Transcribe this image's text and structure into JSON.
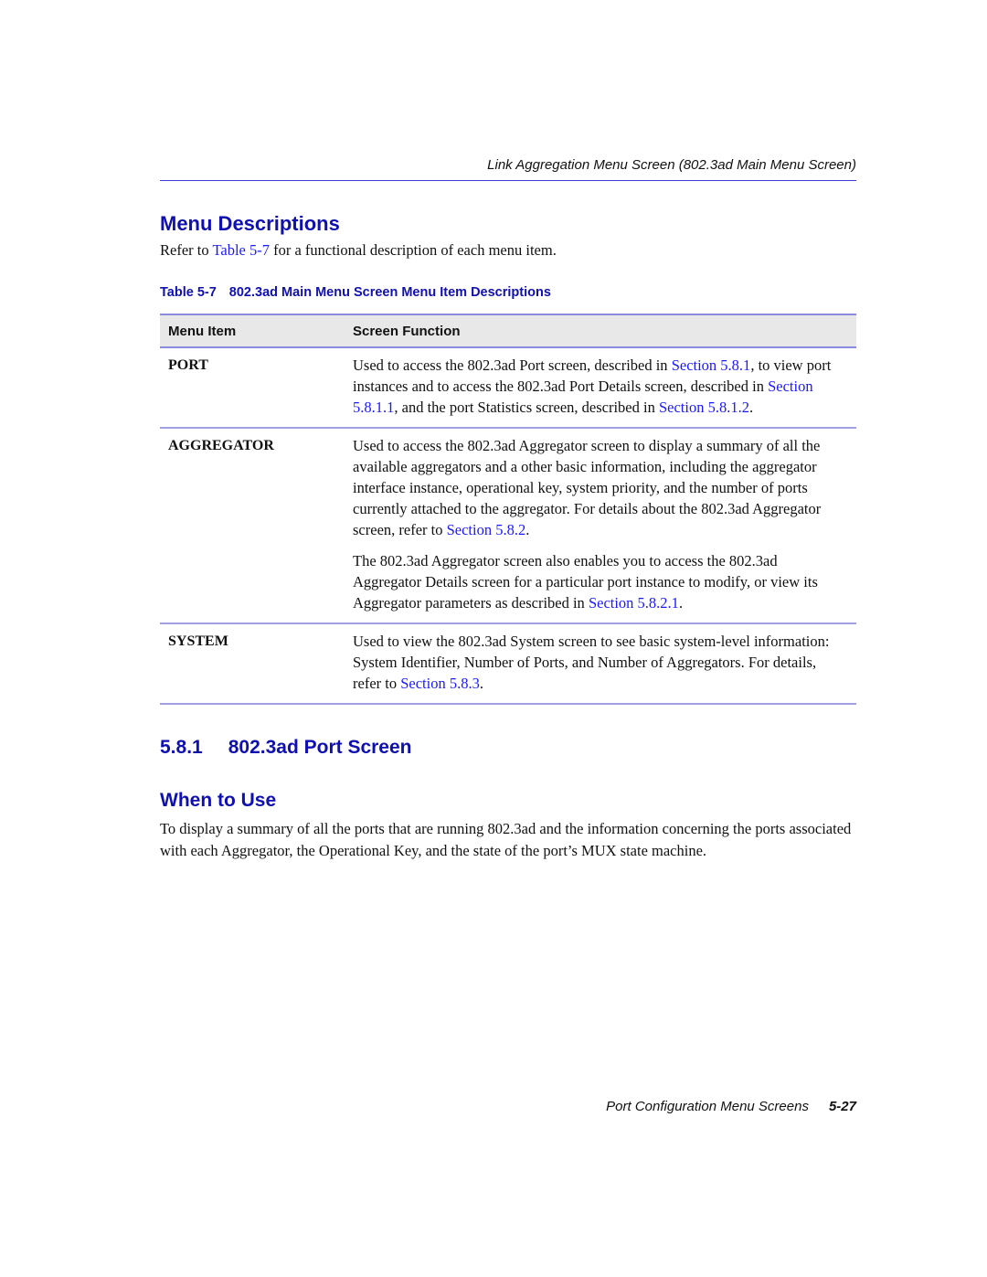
{
  "running_head": "Link Aggregation Menu Screen (802.3ad Main Menu Screen)",
  "menu_descriptions": {
    "heading": "Menu Descriptions",
    "intro_prefix": "Refer to ",
    "intro_link": "Table 5-7",
    "intro_suffix": " for a functional description of each menu item."
  },
  "table": {
    "caption_number": "Table 5-7",
    "caption_title": "802.3ad Main Menu Screen Menu Item Descriptions",
    "headers": [
      "Menu Item",
      "Screen Function"
    ],
    "rows": [
      {
        "item": "PORT",
        "p1": {
          "t1": "Used to access the 802.3ad Port screen, described in ",
          "l1": "Section 5.8.1",
          "t2": ", to view port instances and to access the 802.3ad Port Details screen, described in ",
          "l2": "Section 5.8.1.1",
          "t3": ", and the port Statistics screen, described in ",
          "l3": "Section 5.8.1.2",
          "t4": "."
        }
      },
      {
        "item": "AGGREGATOR",
        "p1": {
          "t1": "Used to access the 802.3ad Aggregator screen to display a summary of all the available aggregators and a other basic information, including the aggregator interface instance, operational key, system priority, and the number of ports currently attached to the aggregator. For details about the 802.3ad Aggregator screen, refer to ",
          "l1": "Section 5.8.2",
          "t2": "."
        },
        "p2": {
          "t1": "The 802.3ad Aggregator screen also enables you to access the 802.3ad Aggregator Details screen for a particular port instance to modify, or view its Aggregator parameters as described in ",
          "l1": "Section 5.8.2.1",
          "t2": "."
        }
      },
      {
        "item": "SYSTEM",
        "p1": {
          "t1": "Used to view the 802.3ad System screen to see basic system-level information: System Identifier, Number of Ports, and Number of Aggregators. For details, refer to ",
          "l1": "Section 5.8.3",
          "t2": "."
        }
      }
    ]
  },
  "section_581": {
    "number": "5.8.1",
    "title": "802.3ad Port Screen"
  },
  "when_to_use": {
    "heading": "When to Use",
    "body": "To display a summary of all the ports that are running 802.3ad and the information concerning the ports associated with each Aggregator, the Operational Key, and the state of the port’s MUX state machine."
  },
  "footer": {
    "title": "Port Configuration Menu Screens",
    "page_number": "5-27"
  },
  "colors": {
    "heading_blue": "#1010b0",
    "link_blue": "#1a1aff",
    "rule_blue": "#8a8ae0",
    "table_header_bg": "#e8e8e8"
  }
}
